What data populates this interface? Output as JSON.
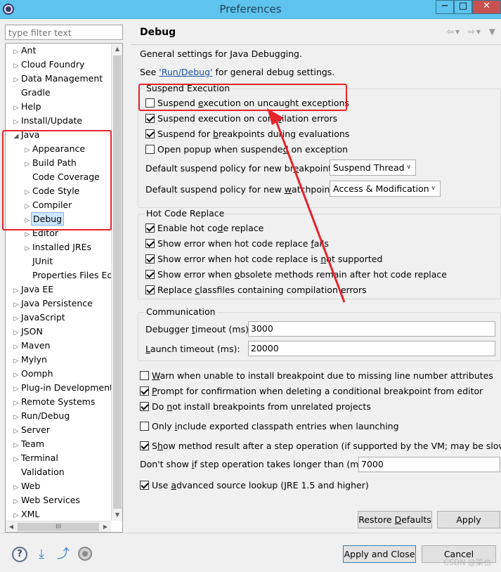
{
  "window": {
    "title": "Preferences",
    "controls": {
      "minimize": "−",
      "maximize": "□",
      "close": "✕"
    }
  },
  "left": {
    "filter_placeholder": "type filter text",
    "tree": [
      {
        "label": "Ant",
        "exp": "▷",
        "level": 0
      },
      {
        "label": "Cloud Foundry",
        "exp": "▷",
        "level": 0
      },
      {
        "label": "Data Management",
        "exp": "▷",
        "level": 0
      },
      {
        "label": "Gradle",
        "exp": "",
        "level": 0
      },
      {
        "label": "Help",
        "exp": "▷",
        "level": 0
      },
      {
        "label": "Install/Update",
        "exp": "▷",
        "level": 0
      },
      {
        "label": "Java",
        "exp": "◢",
        "level": 0
      },
      {
        "label": "Appearance",
        "exp": "▷",
        "level": 1
      },
      {
        "label": "Build Path",
        "exp": "▷",
        "level": 1
      },
      {
        "label": "Code Coverage",
        "exp": "",
        "level": 1
      },
      {
        "label": "Code Style",
        "exp": "▷",
        "level": 1
      },
      {
        "label": "Compiler",
        "exp": "▷",
        "level": 1
      },
      {
        "label": "Debug",
        "exp": "▷",
        "level": 1,
        "selected": true
      },
      {
        "label": "Editor",
        "exp": "▷",
        "level": 1
      },
      {
        "label": "Installed JREs",
        "exp": "▷",
        "level": 1
      },
      {
        "label": "JUnit",
        "exp": "",
        "level": 1
      },
      {
        "label": "Properties Files Edit",
        "exp": "",
        "level": 1
      },
      {
        "label": "Java EE",
        "exp": "▷",
        "level": 0
      },
      {
        "label": "Java Persistence",
        "exp": "▷",
        "level": 0
      },
      {
        "label": "JavaScript",
        "exp": "▷",
        "level": 0
      },
      {
        "label": "JSON",
        "exp": "▷",
        "level": 0
      },
      {
        "label": "Maven",
        "exp": "▷",
        "level": 0
      },
      {
        "label": "Mylyn",
        "exp": "▷",
        "level": 0
      },
      {
        "label": "Oomph",
        "exp": "▷",
        "level": 0
      },
      {
        "label": "Plug-in Development",
        "exp": "▷",
        "level": 0
      },
      {
        "label": "Remote Systems",
        "exp": "▷",
        "level": 0
      },
      {
        "label": "Run/Debug",
        "exp": "▷",
        "level": 0
      },
      {
        "label": "Server",
        "exp": "▷",
        "level": 0
      },
      {
        "label": "Team",
        "exp": "▷",
        "level": 0
      },
      {
        "label": "Terminal",
        "exp": "▷",
        "level": 0
      },
      {
        "label": "Validation",
        "exp": "",
        "level": 0
      },
      {
        "label": "Web",
        "exp": "▷",
        "level": 0
      },
      {
        "label": "Web Services",
        "exp": "▷",
        "level": 0
      },
      {
        "label": "XML",
        "exp": "▷",
        "level": 0
      }
    ],
    "hscroll_grip": "III"
  },
  "page": {
    "title": "Debug",
    "nav": {
      "back": "⇦",
      "back_menu": "▾",
      "forward": "⇨",
      "forward_menu": "▾",
      "menu": "▼"
    },
    "intro": "General settings for Java Debugging.",
    "see_prefix": "See ",
    "see_link": "'Run/Debug'",
    "see_suffix": " for general debug settings.",
    "suspend": {
      "label": "Suspend Execution",
      "uncaught": {
        "pre": "Suspend ",
        "u": "e",
        "post": "xecution on uncaught exceptions",
        "checked": false
      },
      "compilation": {
        "pre": "Suspend execution on com",
        "u": "p",
        "post": "ilation errors",
        "checked": true
      },
      "breakpoints_eval": {
        "pre": "Suspend for ",
        "u": "b",
        "post": "reakpoints during evaluations",
        "checked": true
      },
      "popup": {
        "pre": "Open popup when suspende",
        "u": "d",
        "post": " on exception",
        "checked": false
      },
      "policy_breakpoints_label": "Default suspend policy for new br",
      "policy_breakpoints_u": "e",
      "policy_breakpoints_post": "akpoints:",
      "policy_breakpoints_value": "Suspend Thread",
      "policy_watchpoints_label": "Default suspend policy for new ",
      "policy_watchpoints_u": "w",
      "policy_watchpoints_post": "atchpoints:",
      "policy_watchpoints_value": "Access & Modification"
    },
    "hcr": {
      "label": "Hot Code Replace",
      "enable": {
        "pre": "Enable hot co",
        "u": "d",
        "post": "e replace",
        "checked": true
      },
      "fails": {
        "pre": "Show error when hot code replace ",
        "u": "f",
        "post": "ails",
        "checked": true
      },
      "not_supported": {
        "pre": "Show error when hot code replace is ",
        "u": "n",
        "post": "ot supported",
        "checked": true
      },
      "obsolete": {
        "pre": "Show error when ",
        "u": "o",
        "post": "bsolete methods remain after hot code replace",
        "checked": true
      },
      "replace_classfiles": {
        "pre": "Replace ",
        "u": "c",
        "post": "lassfiles containing compilation errors",
        "checked": true
      }
    },
    "comm": {
      "label": "Communication",
      "debugger_timeout_pre": "Debugger ",
      "debugger_timeout_u": "t",
      "debugger_timeout_post": "imeout (ms):",
      "debugger_timeout_value": "3000",
      "launch_timeout_u": "L",
      "launch_timeout_post": "aunch timeout (ms):",
      "launch_timeout_value": "20000"
    },
    "misc": {
      "warn_missing": {
        "pre": "",
        "u": "W",
        "post": "arn when unable to install breakpoint due to missing line number attributes",
        "checked": false
      },
      "prompt_conditional": {
        "pre": "",
        "u": "P",
        "post": "rompt for confirmation when deleting a conditional breakpoint from editor",
        "checked": true
      },
      "unrelated": {
        "pre": "Do ",
        "u": "n",
        "post": "ot install breakpoints from unrelated projects",
        "checked": true
      },
      "exported_classpath": {
        "pre": "Only ",
        "u": "i",
        "post": "nclude exported classpath entries when launching",
        "checked": false
      },
      "method_result": {
        "pre": "S",
        "u": "h",
        "post": "ow method result after a step operation (if supported by the VM; may be slow)",
        "checked": true
      },
      "step_longer_pre": "Don't show ",
      "step_longer_u": "i",
      "step_longer_post": "f step operation takes longer than (ms):",
      "step_longer_value": "7000",
      "advanced_lookup": {
        "pre": "Use ",
        "u": "a",
        "post": "dvanced source lookup (JRE 1.5 and higher)",
        "checked": true
      }
    },
    "restore_defaults_pre": "Restore ",
    "restore_defaults_u": "D",
    "restore_defaults_post": "efaults",
    "apply": "Apply",
    "apply_close": "Apply and Close",
    "cancel": "Cancel"
  },
  "footer": {
    "help": "?",
    "import_icon": "⤓",
    "export_icon": "⤴",
    "watermark": "CSDN @菜也"
  },
  "colors": {
    "titlebar": "#5ec4ee",
    "annotation": "#e8242c",
    "link": "#1a4fa0",
    "selection": "#cde8ff"
  }
}
